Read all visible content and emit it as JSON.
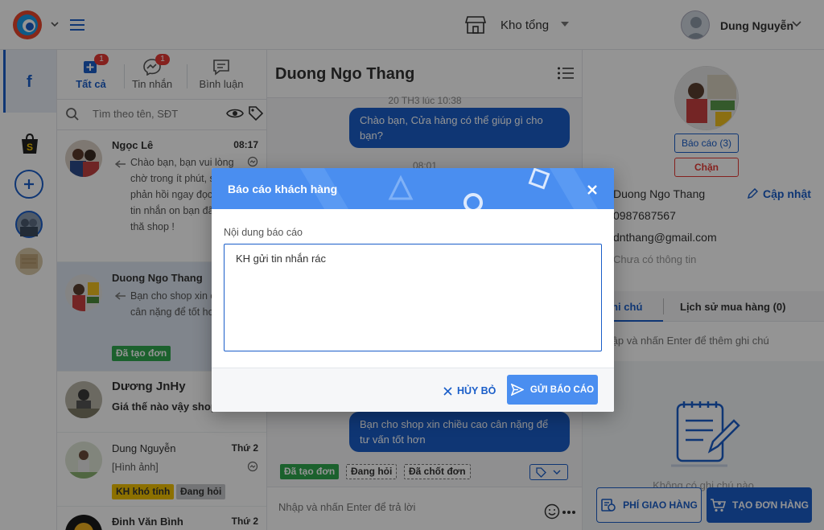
{
  "colors": {
    "brand": "#1a5ec9",
    "modal_header": "#4a8ef0",
    "danger": "#e53935",
    "success": "#2fa84f",
    "warning": "#f2c200"
  },
  "header": {
    "store_name": "Kho tổng",
    "user_name": "Dung Nguyễn"
  },
  "conv_tabs": [
    {
      "label": "Tất cả",
      "badge": "1",
      "icon": "all-inbox-icon"
    },
    {
      "label": "Tin nhắn",
      "badge": "1",
      "icon": "messenger-icon"
    },
    {
      "label": "Bình luận",
      "badge": "",
      "icon": "comment-icon"
    }
  ],
  "search": {
    "placeholder": "Tìm theo tên, SĐT"
  },
  "conversations": [
    {
      "name": "Ngọc Lê",
      "time": "08:17",
      "preview": "Chào bạn, bạn vui lòng chờ trong ít phút, sẽ phản hồi ngay đọc được tin nhắn on bạn đã ghé thă shop !",
      "tags": []
    },
    {
      "name": "Duong Ngo Thang",
      "time": "",
      "preview": "Bạn cho shop xin cao cân nặng để tốt hơn",
      "tags": [
        "Đã tạo đơn"
      ]
    },
    {
      "name": "Dương JnHy",
      "time": "",
      "preview": "Giá thế nào vậy shop",
      "tags": []
    },
    {
      "name": "Dung Nguyễn",
      "time": "Thứ 2",
      "preview": "[Hình ảnh]",
      "tags": [
        "KH khó tính",
        "Đang hỏi"
      ]
    },
    {
      "name": "Đinh Văn Bình",
      "time": "Thứ 2",
      "preview": "",
      "tags": []
    }
  ],
  "chat": {
    "title": "Duong Ngo Thang",
    "time1": "20 TH3 lúc 10:38",
    "bubble1": "Chào bạn, Cửa hàng có thể giúp gì cho bạn?",
    "time2": "08:01",
    "bubble2": "Bạn cho shop xin chiều cao cân nặng để tư vấn tốt hơn",
    "tags": [
      "Đã tạo đơn",
      "Đang hỏi",
      "Đã chốt đơn"
    ],
    "input_placeholder": "Nhập và nhấn Enter để trả lời"
  },
  "profile": {
    "report_label": "Báo cáo (3)",
    "block_label": "Chặn",
    "name": "Duong Ngo Thang",
    "update_label": "Cập nhật",
    "phone": "0987687567",
    "email": "dnthang@gmail.com",
    "address": "Chưa có thông tin",
    "tab_notes": "Ghi chú",
    "tab_history": "Lịch sử mua hàng (0)",
    "note_placeholder": "Nhập và nhấn Enter để thêm ghi chú",
    "empty_notes": "Không có ghi chú nào",
    "ship_fee_label": "PHÍ GIAO HÀNG",
    "create_order_label": "TẠO ĐƠN HÀNG"
  },
  "modal": {
    "title": "Báo cáo khách hàng",
    "field_label": "Nội dung báo cáo",
    "field_value": "KH gửi tin nhắn rác",
    "cancel_label": "HỦY BỎ",
    "submit_label": "GỬI BÁO CÁO"
  }
}
